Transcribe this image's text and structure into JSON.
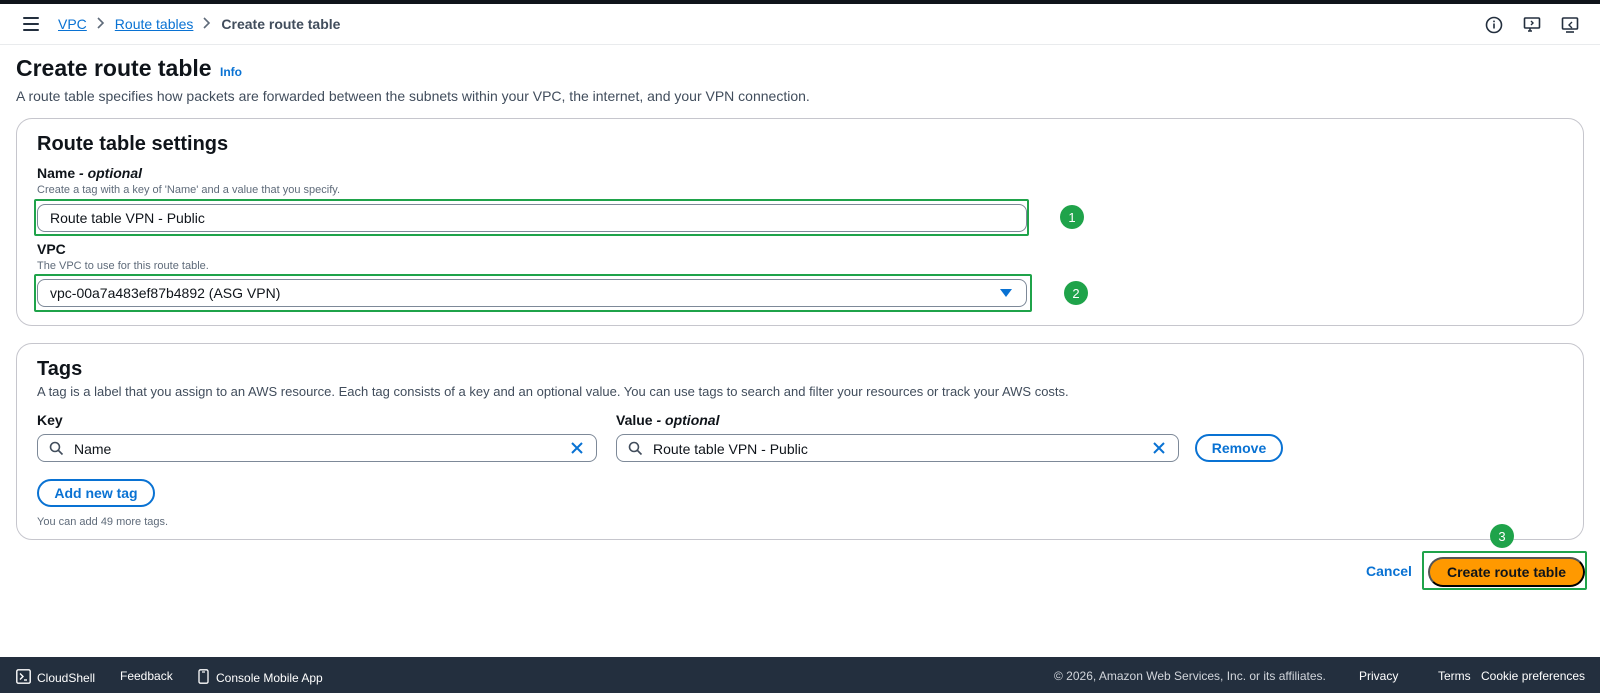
{
  "breadcrumb": {
    "items": [
      {
        "label": "VPC"
      },
      {
        "label": "Route tables"
      }
    ],
    "current": "Create route table"
  },
  "header": {
    "title": "Create route table",
    "info": "Info",
    "description": "A route table specifies how packets are forwarded between the subnets within your VPC, the internet, and your VPN connection."
  },
  "settings": {
    "title": "Route table settings",
    "name_label": "Name",
    "name_optional": "- optional",
    "name_hint": "Create a tag with a key of 'Name' and a value that you specify.",
    "name_value": "Route table VPN - Public",
    "vpc_label": "VPC",
    "vpc_hint": "The VPC to use for this route table.",
    "vpc_value": "vpc-00a7a483ef87b4892 (ASG VPN)"
  },
  "tags": {
    "title": "Tags",
    "description": "A tag is a label that you assign to an AWS resource. Each tag consists of a key and an optional value. You can use tags to search and filter your resources or track your AWS costs.",
    "key_label": "Key",
    "value_label": "Value",
    "value_optional": "- optional",
    "key_value": "Name",
    "value_value": "Route table VPN - Public",
    "remove_label": "Remove",
    "add_label": "Add new tag",
    "limit_text": "You can add 49 more tags."
  },
  "actions": {
    "cancel": "Cancel",
    "create": "Create route table"
  },
  "annotations": [
    "1",
    "2",
    "3"
  ],
  "footer": {
    "cloudshell": "CloudShell",
    "feedback": "Feedback",
    "mobile_app": "Console Mobile App",
    "copyright": "© 2026, Amazon Web Services, Inc. or its affiliates.",
    "privacy": "Privacy",
    "terms": "Terms",
    "cookies": "Cookie preferences"
  },
  "colors": {
    "link": "#0972d3",
    "primary_button": "#ff9900",
    "annotation_green": "#1fa34a",
    "footer_bg": "#232f3e"
  }
}
